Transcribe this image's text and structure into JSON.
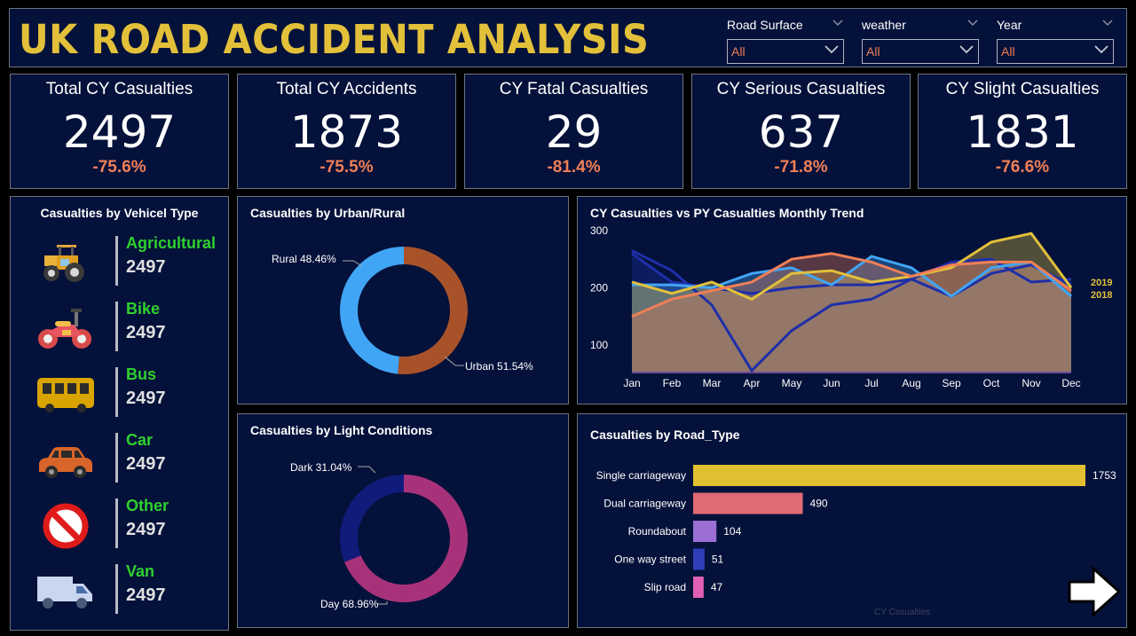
{
  "header": {
    "title": "UK ROAD ACCIDENT ANALYSIS",
    "filters": [
      {
        "label": "Road Surface",
        "value": "All"
      },
      {
        "label": "weather",
        "value": "All"
      },
      {
        "label": "Year",
        "value": "All"
      }
    ]
  },
  "kpis": [
    {
      "title": "Total CY Casualties",
      "value": "2497",
      "change": "-75.6%"
    },
    {
      "title": "Total CY Accidents",
      "value": "1873",
      "change": "-75.5%"
    },
    {
      "title": "CY Fatal Casualties",
      "value": "29",
      "change": "-81.4%"
    },
    {
      "title": "CY Serious Casualties",
      "value": "637",
      "change": "-71.8%"
    },
    {
      "title": "CY Slight Casualties",
      "value": "1831",
      "change": "-76.6%"
    }
  ],
  "vehicles": {
    "title": "Casualties by Vehicel Type",
    "items": [
      {
        "label": "Agricultural",
        "value": "2497",
        "icon": "tractor-icon"
      },
      {
        "label": "Bike",
        "value": "2497",
        "icon": "motorbike-icon"
      },
      {
        "label": "Bus",
        "value": "2497",
        "icon": "bus-icon"
      },
      {
        "label": "Car",
        "value": "2497",
        "icon": "car-icon"
      },
      {
        "label": "Other",
        "value": "2497",
        "icon": "no-entry-icon"
      },
      {
        "label": "Van",
        "value": "2497",
        "icon": "van-icon"
      }
    ]
  },
  "footer": {
    "hint": "CY Casualties"
  },
  "colors": {
    "rural": "#41a5f5",
    "urban": "#a8522a",
    "dark": "#111b7a",
    "day": "#a83279",
    "accent": "#e3c03a",
    "negative": "#f07f57"
  },
  "chart_data": [
    {
      "id": "urban-rural",
      "type": "pie",
      "title": "Casualties by Urban/Rural",
      "labels": [
        "Rural 48.46%",
        "Urban 51.54%"
      ],
      "values": [
        48.46,
        51.54
      ],
      "colors": [
        "#41a5f5",
        "#a8522a"
      ]
    },
    {
      "id": "light-conditions",
      "type": "pie",
      "title": "Casualties by Light Conditions",
      "labels": [
        "Dark 31.04%",
        "Day 68.96%"
      ],
      "values": [
        31.04,
        68.96
      ],
      "colors": [
        "#111b7a",
        "#a83279"
      ]
    },
    {
      "id": "monthly-trend",
      "type": "area",
      "title": "CY Casualties vs PY Casualties Monthly Trend",
      "categories": [
        "Jan",
        "Feb",
        "Mar",
        "Apr",
        "May",
        "Jun",
        "Jul",
        "Aug",
        "Sep",
        "Oct",
        "Nov",
        "Dec"
      ],
      "yticks": [
        100,
        200,
        300
      ],
      "ylim": [
        50,
        300
      ],
      "legend": [
        "2019",
        "2018"
      ],
      "series": [
        {
          "values": [
            265,
            230,
            170,
            55,
            125,
            170,
            180,
            215,
            185,
            225,
            240,
            205
          ],
          "color": "#1f2fa8",
          "fill": false
        },
        {
          "values": [
            260,
            210,
            200,
            190,
            200,
            205,
            205,
            215,
            245,
            250,
            210,
            215
          ],
          "color": "#1f2fa8",
          "fill": true
        },
        {
          "values": [
            205,
            205,
            200,
            225,
            235,
            205,
            255,
            235,
            185,
            235,
            245,
            185
          ],
          "color": "#41a5f5",
          "fill": true
        },
        {
          "values": [
            210,
            190,
            210,
            180,
            225,
            230,
            210,
            220,
            235,
            280,
            295,
            200
          ],
          "color": "#e3c03a",
          "fill": true
        },
        {
          "values": [
            150,
            180,
            195,
            210,
            250,
            260,
            245,
            220,
            240,
            245,
            245,
            195
          ],
          "color": "#f07f57",
          "fill": true
        }
      ]
    },
    {
      "id": "road-type",
      "type": "bar",
      "title": "Casualties by Road_Type",
      "categories": [
        "Single carriageway",
        "Dual carriageway",
        "Roundabout",
        "One way street",
        "Slip road"
      ],
      "values": [
        1753,
        490,
        104,
        51,
        47
      ],
      "colors": [
        "#e0c030",
        "#e06a75",
        "#9b6fd4",
        "#2e3fb8",
        "#e060b5"
      ]
    }
  ]
}
